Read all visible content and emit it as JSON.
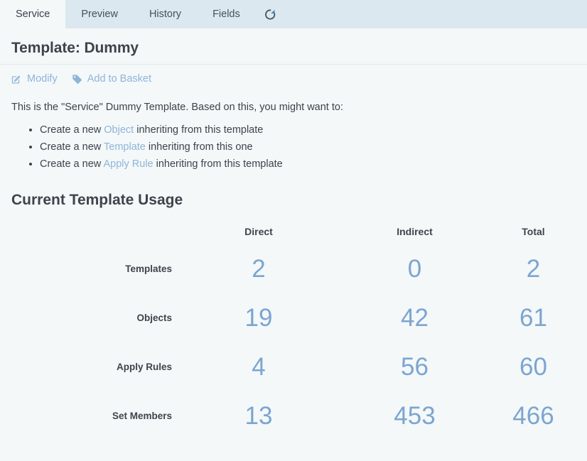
{
  "tabs": [
    {
      "label": "Service",
      "active": true
    },
    {
      "label": "Preview",
      "active": false
    },
    {
      "label": "History",
      "active": false
    },
    {
      "label": "Fields",
      "active": false
    }
  ],
  "refresh_icon": "refresh-icon",
  "header": {
    "title": "Template: Dummy"
  },
  "actions": [
    {
      "label": "Modify",
      "icon": "edit-pencil-square-icon"
    },
    {
      "label": "Add to Basket",
      "icon": "tag-icon"
    }
  ],
  "intro": "This is the \"Service\" Dummy Template. Based on this, you might want to:",
  "bullets": [
    {
      "prefix": "Create a new ",
      "link": "Object",
      "suffix": " inheriting from this template"
    },
    {
      "prefix": "Create a new ",
      "link": "Template",
      "suffix": " inheriting from this one"
    },
    {
      "prefix": "Create a new ",
      "link": "Apply Rule",
      "suffix": " inheriting from this template"
    }
  ],
  "usage": {
    "section_title": "Current Template Usage",
    "columns": [
      "Direct",
      "Indirect",
      "Total"
    ],
    "rows": [
      {
        "label": "Templates",
        "direct": "2",
        "indirect": "0",
        "total": "2"
      },
      {
        "label": "Objects",
        "direct": "19",
        "indirect": "42",
        "total": "61"
      },
      {
        "label": "Apply Rules",
        "direct": "4",
        "indirect": "56",
        "total": "60"
      },
      {
        "label": "Set Members",
        "direct": "13",
        "indirect": "453",
        "total": "466"
      }
    ]
  },
  "colors": {
    "tabbar_bg": "#dce8ef",
    "page_bg": "#f4f8f9",
    "link": "#8fb4d9",
    "number": "#7ca5d0",
    "text": "#3c4349"
  }
}
